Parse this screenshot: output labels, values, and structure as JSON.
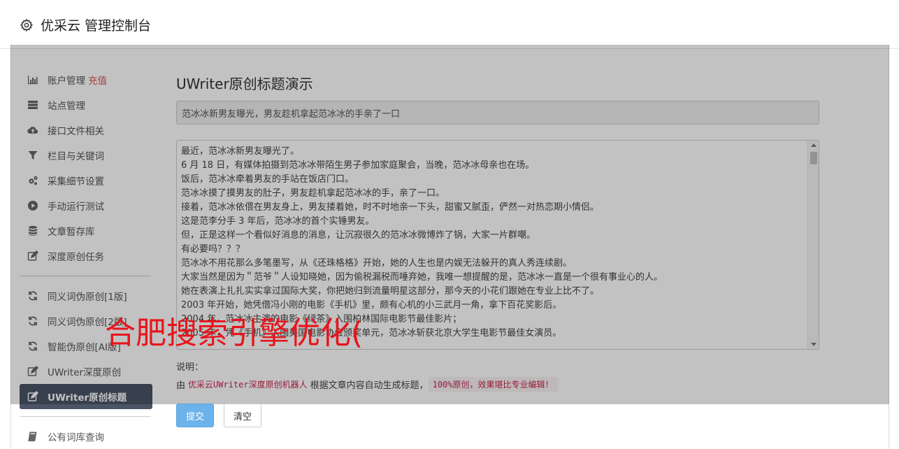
{
  "app": {
    "title": "优采云 管理控制台"
  },
  "sidebar": {
    "items": [
      {
        "label": "账户管理",
        "badge": "充值",
        "icon": "bar-chart-icon"
      },
      {
        "label": "站点管理",
        "icon": "server-icon"
      },
      {
        "label": "接口文件相关",
        "icon": "cloud-upload-icon"
      },
      {
        "label": "栏目与关键词",
        "icon": "filter-icon"
      },
      {
        "label": "采集细节设置",
        "icon": "cogs-icon"
      },
      {
        "label": "手动运行测试",
        "icon": "play-circle-icon"
      },
      {
        "label": "文章暂存库",
        "icon": "database-icon"
      },
      {
        "label": "深度原创任务",
        "icon": "edit-icon"
      }
    ],
    "items2": [
      {
        "label": "同义词伪原创[1版]",
        "icon": "refresh-icon"
      },
      {
        "label": "同义词伪原创[2版]",
        "icon": "refresh-icon"
      },
      {
        "label": "智能伪原创[AI版]",
        "icon": "refresh-icon"
      },
      {
        "label": "UWriter深度原创",
        "icon": "edit-icon"
      },
      {
        "label": "UWriter原创标题",
        "icon": "edit-icon",
        "active": true
      }
    ],
    "items3": [
      {
        "label": "公有词库查询",
        "icon": "book-icon"
      }
    ]
  },
  "main": {
    "heading": "UWriter原创标题演示",
    "title_value": "范冰冰新男友曝光，男友趁机拿起范冰冰的手亲了一口",
    "body_lines": [
      "最近，范冰冰新男友曝光了。",
      "6 月 18 日，有媒体拍摄到范冰冰带陌生男子参加家庭聚会，当晚，范冰冰母亲也在场。",
      "饭后，范冰冰牵着男友的手站在饭店门口。",
      "范冰冰摸了摸男友的肚子，男友趁机拿起范冰冰的手，亲了一口。",
      "接着，范冰冰依偎在男友身上，男友搂着她，时不时地亲一下头，甜蜜又腻歪，俨然一对热恋期小情侣。",
      "这是范李分手 3 年后，范冰冰的首个实锤男友。",
      "但，正是这样一个看似好消息的消息，让沉寂很久的范冰冰微博炸了锅，大家一片群嘲。",
      "有必要吗？？？",
      "范冰冰不用花那么多笔墨写，从《还珠格格》开始，她的人生也是内娱无法躲开的真人秀连续剧。",
      "大家当然是因为＂范爷＂人设知晓她，因为偷税漏税而唾弃她，我唯一想提醒的是，范冰冰一直是一个很有事业心的人。",
      "她在表演上扎扎实实拿过国际大奖，你把她归到流量明星这部分，那今天的小花们跟她在专业上比不了。",
      "2003 年开始，她凭借冯小刚的电影《手机》里，颇有心机的小三武月一角，拿下百花奖影后。",
      "2004 年，范冰冰主演的电影《绿茶》入围柏林国际电影节最佳影片；",
      "2005 年，凭《手机》入围美国电影协会颁奖单元，范冰冰斩获北京大学生电影节最佳女演员。"
    ],
    "desc_label": "说明：",
    "desc_prefix": "由",
    "desc_code1": "优采云UWriter深度原创机器人",
    "desc_mid": "根据文章内容自动生成标题，",
    "desc_code2": "100%原创，效果堪比专业编辑！",
    "submit_label": "提交",
    "clear_label": "清空"
  },
  "watermark": "合肥搜索引擎优化("
}
